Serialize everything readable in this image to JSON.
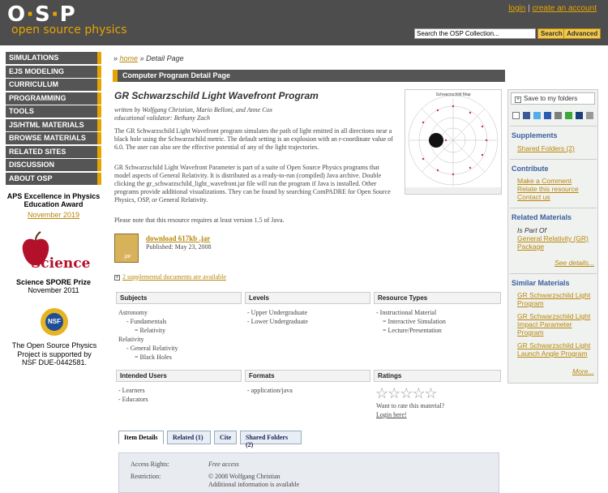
{
  "header": {
    "logo": "OSP",
    "tagline": "open source physics",
    "login": "login",
    "separator": "|",
    "create_account": "create an account",
    "search_placeholder": "Search the OSP Collection...",
    "search_button": "Search",
    "advanced_button": "Advanced"
  },
  "nav": [
    "SIMULATIONS",
    "EJS MODELING",
    "CURRICULUM",
    "PROGRAMMING",
    "TOOLS",
    "JS/HTML MATERIALS",
    "BROWSE MATERIALS",
    "RELATED SITES",
    "DISCUSSION",
    "ABOUT OSP"
  ],
  "awards": {
    "aps_title": "APS Excellence in Physics Education Award",
    "aps_date": "November 2019",
    "science_logo": "Science",
    "spore_title": "Science SPORE Prize",
    "spore_date": "November 2011",
    "nsf_logo": "NSF",
    "nsf_text": "The Open Source Physics Project is supported by NSF DUE-0442581."
  },
  "breadcrumb": {
    "prefix": "»",
    "home": "home",
    "sep": "»",
    "current": "Detail Page"
  },
  "section_bar": "Computer Program Detail Page",
  "resource": {
    "title": "GR Schwarzschild Light Wavefront Program",
    "authors": "written by Wolfgang Christian, Mario Belloni, and Anne Cox",
    "validator": "educational validator: Bethany Zach",
    "para1": "The GR Schwarzschild Light Wavefront program simulates the path of light emitted in all directions near a black hole using the Schwarzschild metric. The default setting is an explosion with an r-coordinate value of 6.0. The user can also see the effective potential of any of the light trajectories.",
    "para2": "GR Schwarzschild Light Wavefront Parameter is part of a suite of Open Source Physics programs that model aspects of General Relativity. It is distributed as a ready-to-run (compiled) Java archive. Double clicking the gr_schwarzschild_light_wavefront.jar file will run the program if Java is installed. Other programs provide additional visualizations. They can be found by searching ComPADRE for Open Source Physics, OSP, or General Relativity.",
    "para3": "Please note that this resource requires at least version 1.5 of Java.",
    "thumb_title": "Schwarzschild Map",
    "download_label": "download 617kb .jar",
    "jar_label": ".jar",
    "published": "Published: May 23, 2008",
    "supplemental": "2 supplemental documents are available",
    "supp_box": "+"
  },
  "table": {
    "headers": [
      "Subjects",
      "Levels",
      "Resource Types"
    ],
    "subjects": [
      "Astronomy",
      "- Fundamentals",
      "= Relativity",
      "Relativity",
      "- General Relativity",
      "= Black Holes"
    ],
    "levels": [
      "- Upper Undergraduate",
      "- Lower Undergraduate"
    ],
    "types": [
      "- Instructional Material",
      "= Interactive Simulation",
      "= Lecture/Presentation"
    ],
    "headers2": [
      "Intended Users",
      "Formats",
      "Ratings"
    ],
    "users": [
      "- Learners",
      "- Educators"
    ],
    "formats": [
      "- application/java"
    ],
    "stars": "☆☆☆☆☆",
    "rate_q": "Want to rate this material?",
    "login": "Login here!"
  },
  "tabs": [
    "Item Details",
    "Related (1)",
    "Cite",
    "Shared Folders (2)"
  ],
  "details": {
    "access_label": "Access Rights:",
    "access_value": "Free access",
    "restriction_label": "Restriction:",
    "restriction_value": "© 2008 Wolfgang Christian",
    "more": "Additional information is available"
  },
  "sidebar": {
    "save": "Save to my folders",
    "save_icon": "+",
    "supplements": "Supplements",
    "shared": "Shared Folders (2)",
    "contribute": "Contribute",
    "comment": "Make a Comment",
    "relate": "Relate this resource",
    "contact": "Contact us",
    "related_materials": "Related Materials",
    "is_part_of": "Is Part Of",
    "gr_package": "General Relativity (GR) Package",
    "see_details": "See details...",
    "similar": "Similar Materials",
    "sim1": "GR Schwarzschild Light Program",
    "sim2": "GR Schwarzschild Light Impact Parameter Program",
    "sim3": "GR Schwarzschild Light Launch Angle Program",
    "more": "More..."
  }
}
